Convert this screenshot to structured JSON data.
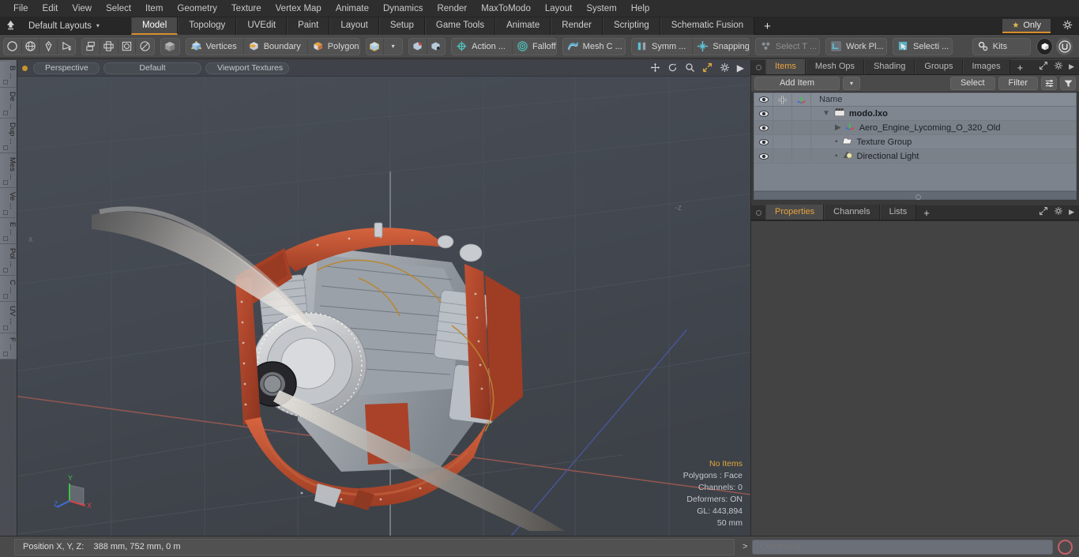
{
  "app": {
    "name": "Modo"
  },
  "menubar": {
    "items": [
      "File",
      "Edit",
      "View",
      "Select",
      "Item",
      "Geometry",
      "Texture",
      "Vertex Map",
      "Animate",
      "Dynamics",
      "Render",
      "MaxToModo",
      "Layout",
      "System",
      "Help"
    ]
  },
  "layoutbar": {
    "home_icon": "home-icon",
    "layout_label": "Default Layouts",
    "caret": "▾",
    "tabs": [
      {
        "label": "Model",
        "active": true
      },
      {
        "label": "Topology",
        "active": false
      },
      {
        "label": "UVEdit",
        "active": false
      },
      {
        "label": "Paint",
        "active": false
      },
      {
        "label": "Layout",
        "active": false
      },
      {
        "label": "Setup",
        "active": false
      },
      {
        "label": "Game Tools",
        "active": false
      },
      {
        "label": "Animate",
        "active": false
      },
      {
        "label": "Render",
        "active": false
      },
      {
        "label": "Scripting",
        "active": false
      },
      {
        "label": "Schematic Fusion",
        "active": false
      }
    ],
    "add_tab": "+",
    "only_label": "Only",
    "only_star": "★",
    "gear": "gear-icon"
  },
  "toolbar": {
    "primitives": [
      "circle-icon",
      "globe-icon",
      "pen-icon",
      "curve-icon"
    ],
    "ops": [
      "array-icon",
      "mirror-icon",
      "boolean-icon",
      "shell-icon"
    ],
    "workplane_icon": "cube-solid-icon",
    "selection_modes": [
      {
        "label": "Vertices",
        "icon": "vertices-cube-icon"
      },
      {
        "label": "Boundary",
        "icon": "boundary-cube-icon"
      },
      {
        "label": "Polygons",
        "icon": "polygons-cube-icon"
      }
    ],
    "item_mode_icon": "item-cube-icon",
    "item_mode_caret": "▾",
    "snap_icons": [
      "snap-vertex-icon",
      "snap-edge-icon"
    ],
    "modes": [
      {
        "label": "Action   ...",
        "icon": "action-center-icon",
        "dim": false
      },
      {
        "label": "Falloff",
        "icon": "falloff-icon",
        "dim": false
      },
      {
        "label": "Mesh C ...",
        "icon": "mesh-constraint-icon",
        "dim": false
      },
      {
        "label": "Symm ...",
        "icon": "symmetry-icon",
        "dim": false
      },
      {
        "label": "Snapping",
        "icon": "snapping-icon",
        "dim": false
      },
      {
        "label": "Select T ...",
        "icon": "select-through-icon",
        "dim": true
      },
      {
        "label": "Work Pl...",
        "icon": "work-plane-icon",
        "dim": false
      },
      {
        "label": "Selecti  ...",
        "icon": "selection-arrow-icon",
        "dim": false
      }
    ],
    "kits_label": "Kits",
    "kits_icon": "gears-icon",
    "round_buttons": [
      "modo-badge-icon",
      "unreal-badge-icon"
    ]
  },
  "left_rail": {
    "tabs": [
      "B ...",
      "De ...",
      "Dup ...",
      "Mes ...",
      "Ve ...",
      "E ...",
      "Pol ...",
      "C ...",
      "UV ...",
      "F ..."
    ]
  },
  "viewport": {
    "dot": "active-viewport-dot",
    "pills": [
      "Perspective",
      "Default",
      "Viewport Textures"
    ],
    "icons": [
      "move-icon",
      "rotate-icon",
      "zoom-icon",
      "fullscreen-icon",
      "gear-icon",
      "chevron-right-icon"
    ],
    "axis_labels": {
      "left": "x",
      "right": "-z"
    },
    "gizmo_axes": [
      "Y",
      "X",
      "Z"
    ],
    "stats": {
      "selection": "No Items",
      "polygons": "Polygons : Face",
      "channels": "Channels: 0",
      "deformers": "Deformers: ON",
      "gl": "GL: 443,894",
      "grid": "50 mm"
    }
  },
  "right_panel": {
    "top_tabs": [
      {
        "label": "Items",
        "active": true
      },
      {
        "label": "Mesh Ops",
        "active": false
      },
      {
        "label": "Shading",
        "active": false
      },
      {
        "label": "Groups",
        "active": false
      },
      {
        "label": "Images",
        "active": false
      }
    ],
    "top_tabs_plus": "+",
    "top_tab_icons": [
      "expand-icon",
      "gear-icon",
      "chevron-right-icon"
    ],
    "add_item_label": "Add Item",
    "add_item_caret": "▾",
    "select_label": "Select",
    "filter_label": "Filter",
    "list_icons": [
      "list-options-icon",
      "funnel-icon"
    ],
    "list_header": {
      "eye_icon": "eye-icon",
      "lock_icon": "crosshair-icon",
      "axis_icon": "axis-icon",
      "name": "Name"
    },
    "items": [
      {
        "name": "modo.lxo",
        "icon": "scene-clapper-icon",
        "depth": 0,
        "bold": true,
        "expander": "▼"
      },
      {
        "name": "Aero_Engine_Lycoming_O_320_Old",
        "icon": "mesh-axis-icon",
        "depth": 1,
        "bold": false,
        "expander": "▶"
      },
      {
        "name": "Texture Group",
        "icon": "folder-icon",
        "depth": 1,
        "bold": false,
        "expander": ""
      },
      {
        "name": "Directional Light",
        "icon": "light-icon",
        "depth": 1,
        "bold": false,
        "expander": ""
      }
    ],
    "bottom_tabs": [
      {
        "label": "Properties",
        "active": true
      },
      {
        "label": "Channels",
        "active": false
      },
      {
        "label": "Lists",
        "active": false
      }
    ],
    "bottom_tabs_plus": "+"
  },
  "statusbar": {
    "position_label": "Position X, Y, Z:",
    "position_value": "388 mm, 752 mm, 0 m",
    "command_prompt": ">",
    "command_placeholder": "Command",
    "command_value": "",
    "record_icon": "record-circle-icon"
  },
  "colors": {
    "accent_orange": "#e8a33d",
    "toolbar_bg": "#4a4a4a",
    "menu_bg": "#2e2e2e",
    "viewport_bg": "#434850",
    "list_bg": "#7d838d",
    "model_red": "#b8462a",
    "model_grey": "#c9cacb"
  }
}
